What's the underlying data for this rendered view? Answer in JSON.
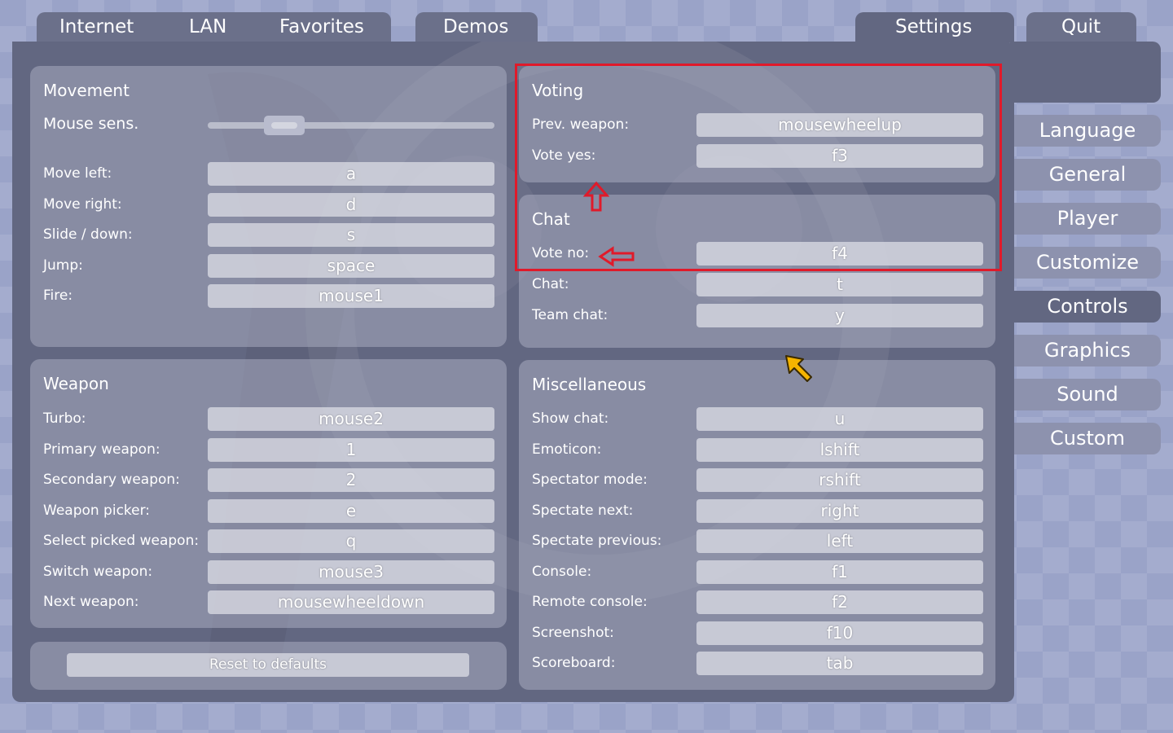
{
  "tabs": {
    "internet": "Internet",
    "lan": "LAN",
    "favorites": "Favorites",
    "demos": "Demos",
    "settings": "Settings",
    "quit": "Quit"
  },
  "sidebar": {
    "items": [
      "Language",
      "General",
      "Player",
      "Customize",
      "Controls",
      "Graphics",
      "Sound",
      "Custom"
    ],
    "active": "Controls"
  },
  "movement": {
    "title": "Movement",
    "mouse_sens_label": "Mouse sens.",
    "mouse_sens_value_fraction": 0.23,
    "rows": [
      {
        "label": "Move left:",
        "key": "a"
      },
      {
        "label": "Move right:",
        "key": "d"
      },
      {
        "label": "Slide / down:",
        "key": "s"
      },
      {
        "label": "Jump:",
        "key": "space"
      },
      {
        "label": "Fire:",
        "key": "mouse1"
      }
    ]
  },
  "weapon": {
    "title": "Weapon",
    "rows": [
      {
        "label": "Turbo:",
        "key": "mouse2"
      },
      {
        "label": "Primary weapon:",
        "key": "1"
      },
      {
        "label": "Secondary weapon:",
        "key": "2"
      },
      {
        "label": "Weapon picker:",
        "key": "e"
      },
      {
        "label": "Select picked weapon:",
        "key": "q"
      },
      {
        "label": "Switch weapon:",
        "key": "mouse3"
      },
      {
        "label": "Next weapon:",
        "key": "mousewheeldown"
      }
    ]
  },
  "reset": {
    "label": "Reset to defaults"
  },
  "voting": {
    "title": "Voting",
    "rows": [
      {
        "label": "Prev. weapon:",
        "key": "mousewheelup"
      },
      {
        "label": "Vote yes:",
        "key": "f3"
      }
    ]
  },
  "chat": {
    "title": "Chat",
    "rows": [
      {
        "label": "Vote no:",
        "key": "f4"
      },
      {
        "label": "Chat:",
        "key": "t"
      },
      {
        "label": "Team chat:",
        "key": "y"
      }
    ]
  },
  "misc": {
    "title": "Miscellaneous",
    "rows": [
      {
        "label": "Show chat:",
        "key": "u"
      },
      {
        "label": "Emoticon:",
        "key": "lshift"
      },
      {
        "label": "Spectator mode:",
        "key": "rshift"
      },
      {
        "label": "Spectate next:",
        "key": "right"
      },
      {
        "label": "Spectate previous:",
        "key": "left"
      },
      {
        "label": "Console:",
        "key": "f1"
      },
      {
        "label": "Remote console:",
        "key": "f2"
      },
      {
        "label": "Screenshot:",
        "key": "f10"
      },
      {
        "label": "Scoreboard:",
        "key": "tab"
      }
    ]
  },
  "colors": {
    "annotation": "#e01a2a",
    "cursor": "#f5b400"
  }
}
